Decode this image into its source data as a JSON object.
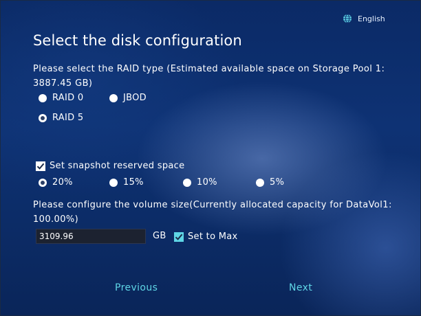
{
  "header": {
    "language": "English",
    "title": "Select the disk configuration"
  },
  "raid": {
    "description": "Please select the RAID type (Estimated available space on Storage Pool 1: 3887.45 GB)",
    "options": [
      {
        "label": "RAID 0",
        "selected": false
      },
      {
        "label": "JBOD",
        "selected": false
      },
      {
        "label": "RAID 5",
        "selected": true
      }
    ]
  },
  "snapshot": {
    "label": "Set snapshot reserved space",
    "checked": true,
    "options": [
      {
        "label": "20%",
        "selected": true
      },
      {
        "label": "15%",
        "selected": false
      },
      {
        "label": "10%",
        "selected": false
      },
      {
        "label": "5%",
        "selected": false
      }
    ]
  },
  "volume": {
    "description": "Please configure the volume size(Currently allocated capacity for DataVol1: 100.00%)",
    "size_value": "3109.96",
    "unit": "GB",
    "set_max_label": "Set to Max",
    "set_max_checked": true
  },
  "footer": {
    "previous_label": "Previous",
    "next_label": "Next"
  },
  "colors": {
    "accent": "#5fd6e6",
    "background": "#0e3274"
  },
  "icons": {
    "language": "globe-icon"
  }
}
